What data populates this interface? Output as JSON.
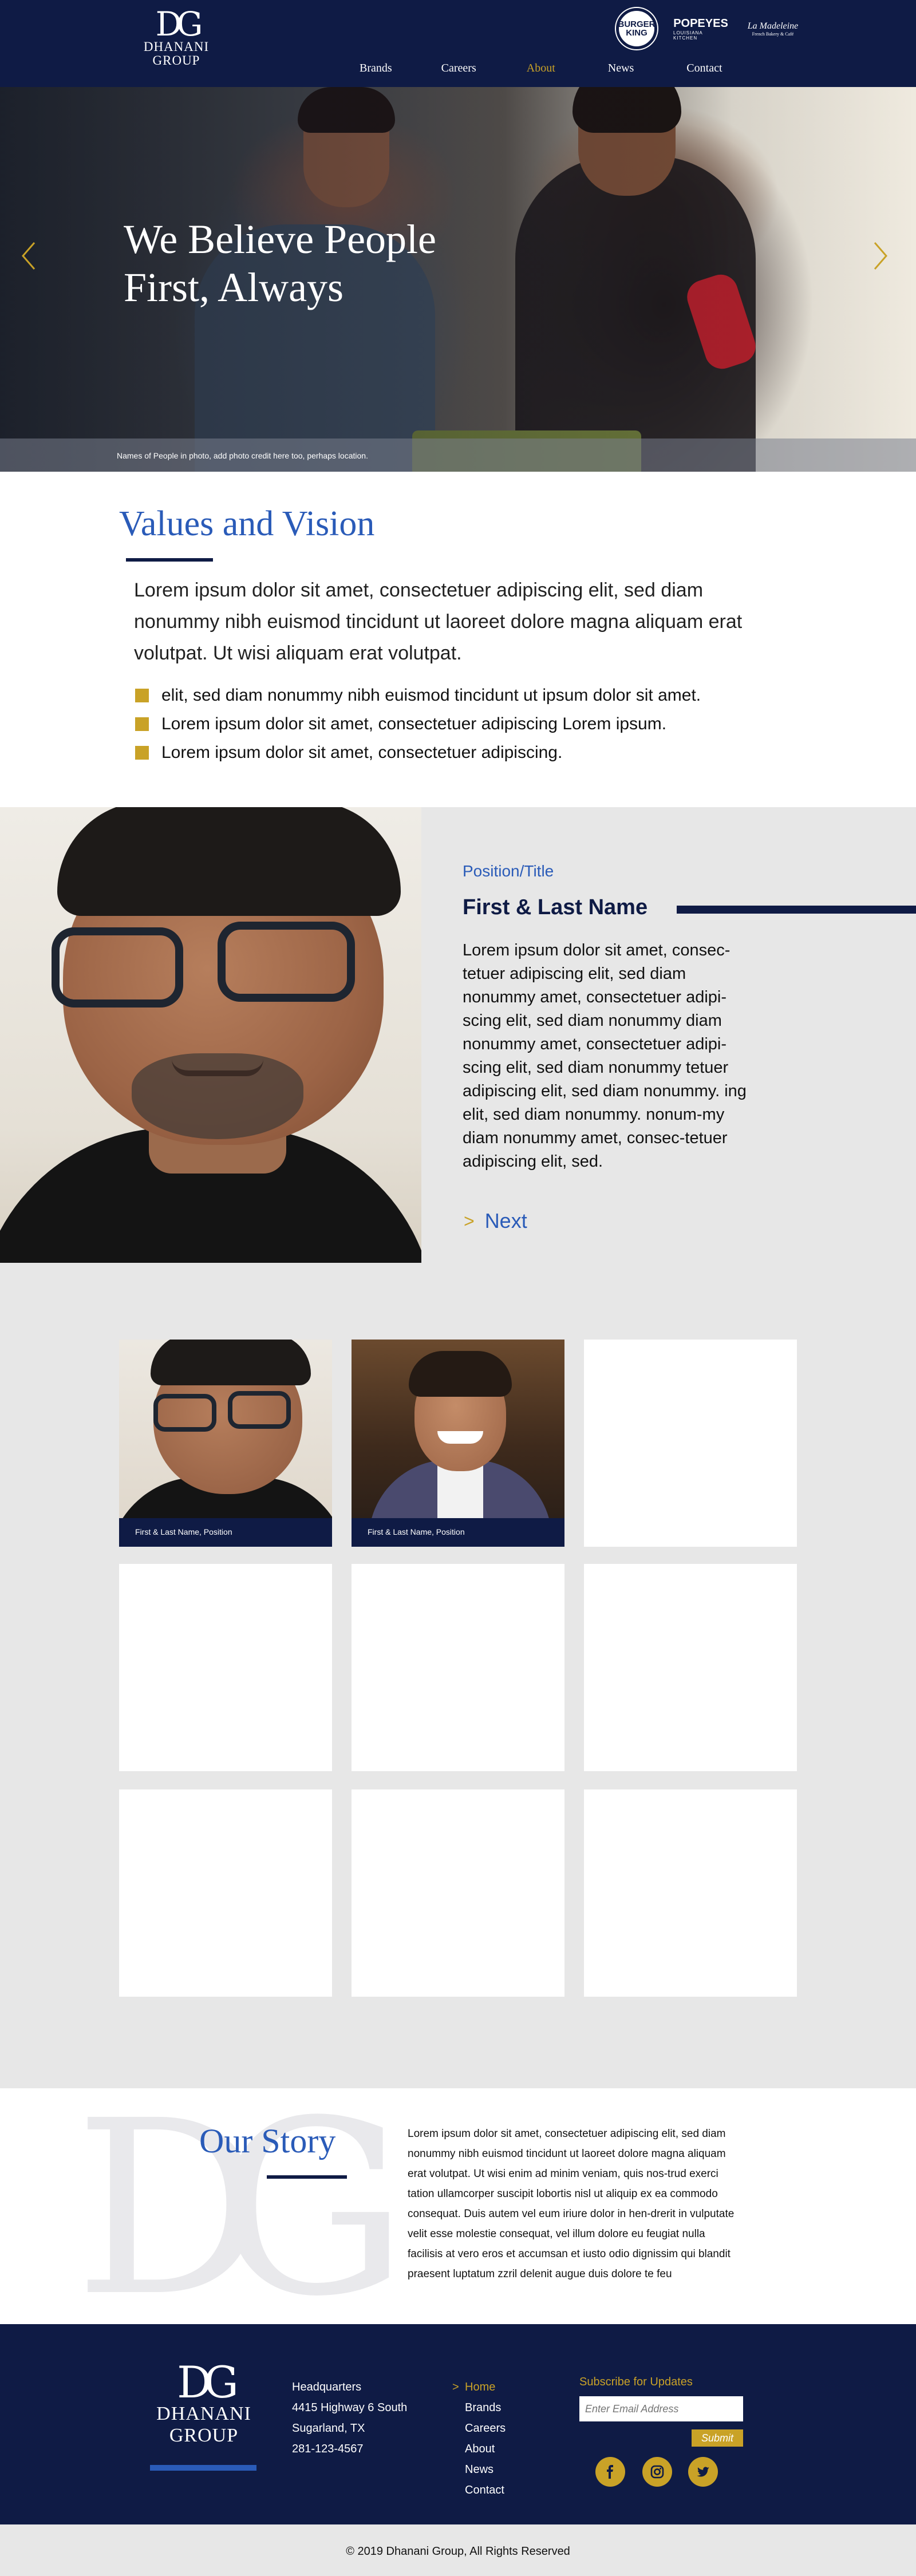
{
  "header": {
    "logo_monogram": "DG",
    "logo_name": "DHANANI GROUP",
    "brand_logos": [
      {
        "name": "Burger King",
        "label": "BURGER KING"
      },
      {
        "name": "Popeyes",
        "label": "POPEYES",
        "sub": "LOUISIANA KITCHEN"
      },
      {
        "name": "La Madeleine",
        "label": "La Madeleine",
        "sub": "French Bakery & Café"
      }
    ],
    "nav": [
      "Brands",
      "Careers",
      "About",
      "News",
      "Contact"
    ],
    "nav_active": "About"
  },
  "hero": {
    "title": "We Believe People First, Always",
    "caption": "Names of People in photo, add photo credit here too, perhaps location.",
    "prev_icon": "chevron-left-icon",
    "next_icon": "chevron-right-icon"
  },
  "values": {
    "title": "Values and Vision",
    "paragraph": "Lorem ipsum dolor sit amet, consectetuer adipiscing elit, sed diam nonummy nibh euismod tincidunt ut laoreet dolore magna aliquam erat volutpat. Ut wisi aliquam erat volutpat.",
    "bullets": [
      "elit, sed diam nonummy nibh euismod tincidunt ut ipsum dolor sit amet.",
      "Lorem ipsum dolor sit amet, consectetuer adipiscing Lorem ipsum.",
      "Lorem ipsum dolor sit amet, consectetuer adipiscing."
    ]
  },
  "profile": {
    "position": "Position/Title",
    "name": "First & Last Name",
    "bio": "Lorem ipsum dolor sit amet, consec-tetuer adipiscing elit, sed diam nonummy amet, consectetuer adipi-scing elit, sed diam nonummy diam nonummy amet, consectetuer adipi-scing elit, sed diam nonummy tetuer adipiscing elit, sed diam nonummy. ing elit, sed diam nonummy.   nonum-my diam nonummy amet, consec-tetuer adipiscing elit, sed.",
    "next_marker": ">",
    "next_label": "Next"
  },
  "team_grid": {
    "cards": [
      {
        "caption": "First & Last Name, Position"
      },
      {
        "caption": "First & Last Name, Position"
      }
    ]
  },
  "story": {
    "monogram": "DG",
    "title": "Our Story",
    "text": "Lorem ipsum dolor sit amet, consectetuer adipiscing elit, sed diam nonummy nibh euismod tincidunt ut laoreet dolore magna aliquam erat volutpat. Ut wisi enim ad minim veniam, quis nos-trud exerci tation ullamcorper suscipit lobortis nisl ut aliquip ex ea commodo consequat. Duis autem vel eum iriure dolor in hen-drerit in vulputate velit esse molestie consequat, vel illum dolore eu feugiat nulla facilisis at vero eros et accumsan et iusto odio dignissim qui blandit praesent luptatum zzril delenit augue duis dolore te feu"
  },
  "footer": {
    "logo_monogram": "DG",
    "logo_name": "DHANANI GROUP",
    "hq": {
      "label": "Headquarters",
      "address1": "4415 Highway 6 South",
      "address2": "Sugarland, TX",
      "phone": "281-123-4567"
    },
    "nav_marker": ">",
    "nav": [
      "Home",
      "Brands",
      "Careers",
      "About",
      "News",
      "Contact"
    ],
    "subscribe_title": "Subscribe for Updates",
    "email_placeholder": "Enter Email Address",
    "submit_label": "Submit",
    "social": [
      "facebook-icon",
      "instagram-icon",
      "twitter-icon"
    ],
    "copyright": "© 2019 Dhanani Group, All Rights Reserved"
  },
  "colors": {
    "navy": "#0f1b45",
    "gold": "#c9a227",
    "blue": "#2a5bb8",
    "gray_bg": "#e7e7e7"
  }
}
